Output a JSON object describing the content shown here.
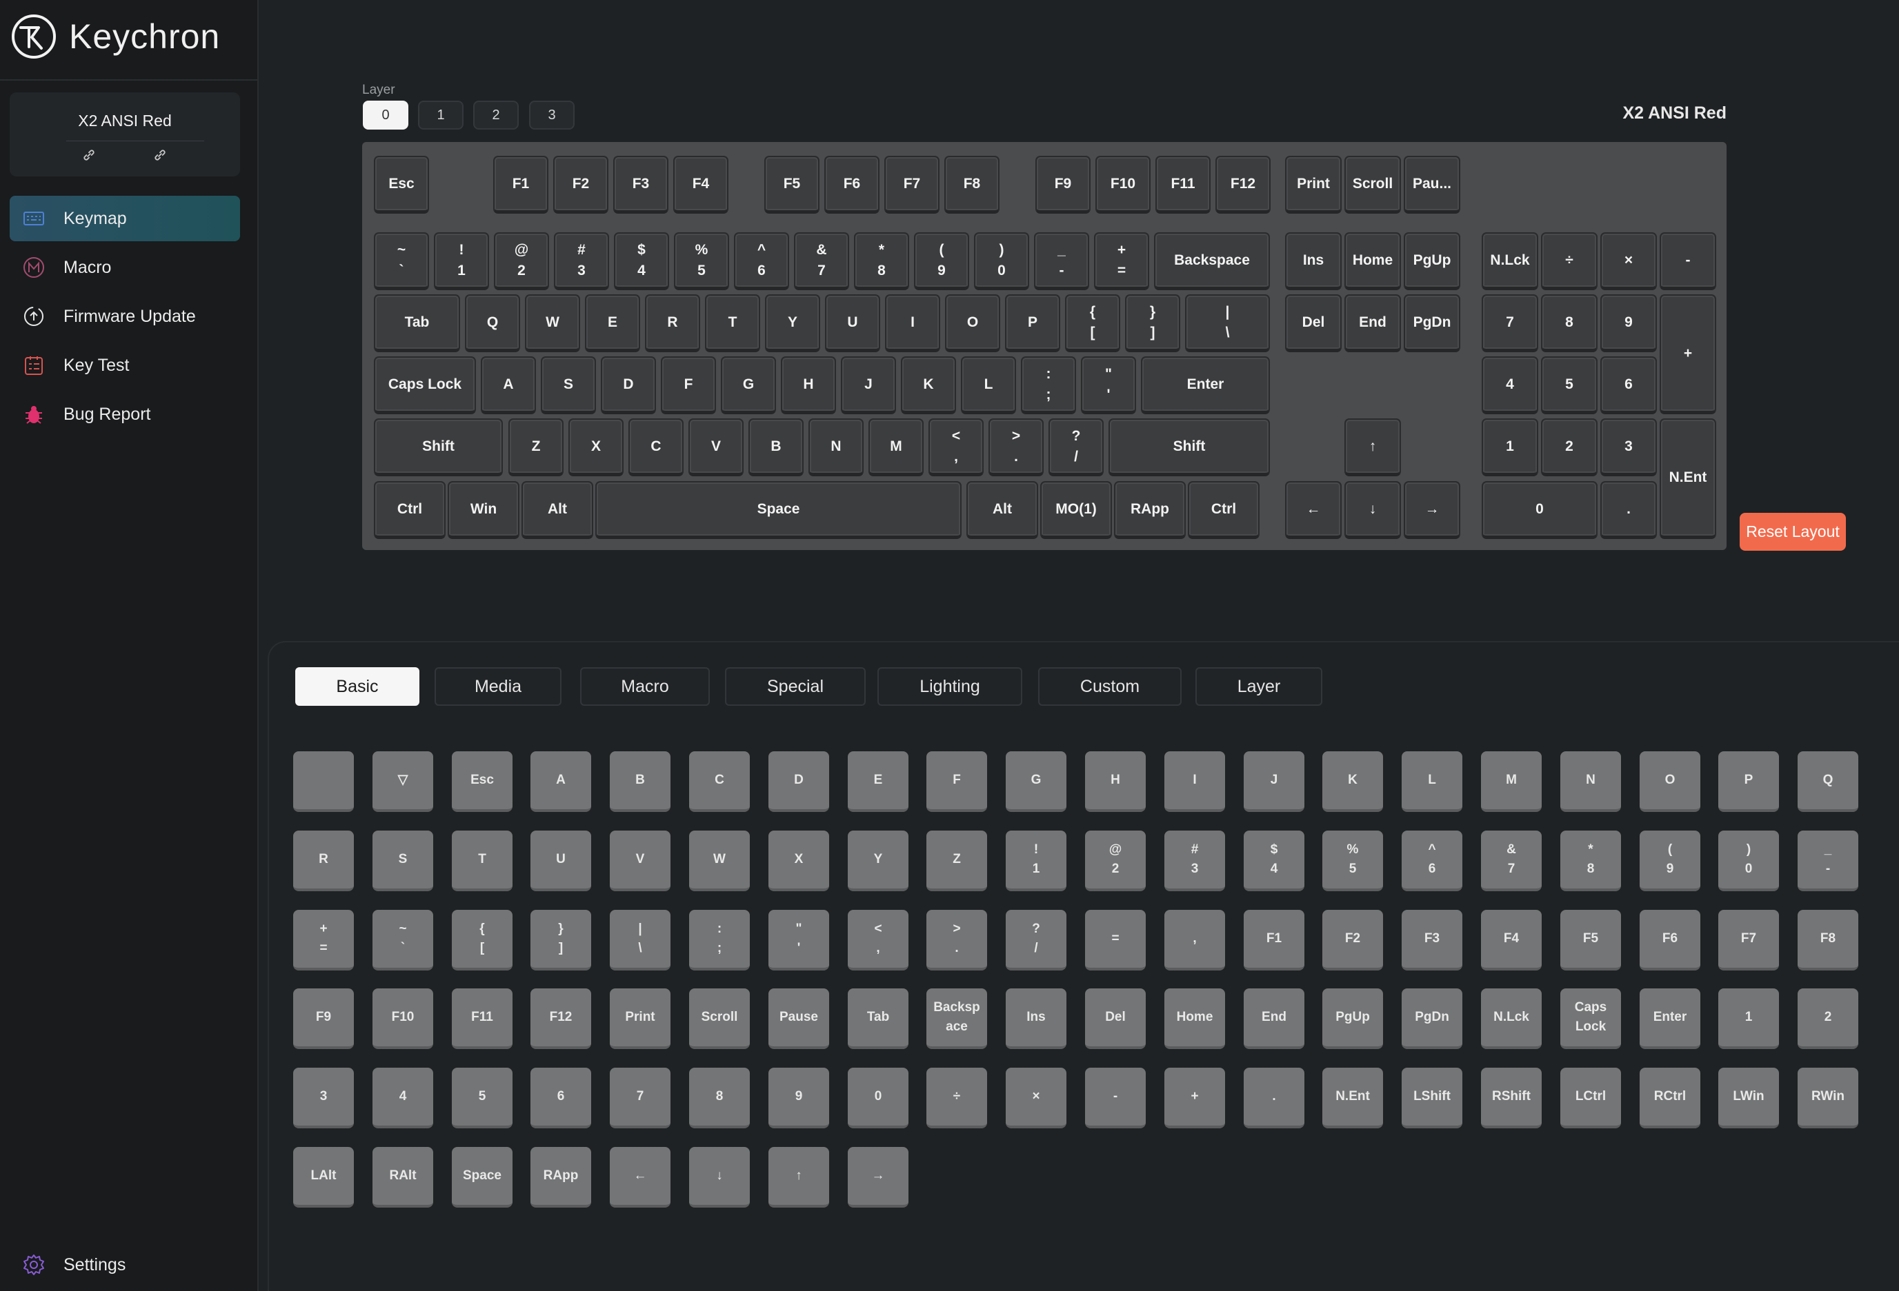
{
  "app": {
    "brand": "Keychron"
  },
  "device": {
    "name": "X2 ANSI Red"
  },
  "nav": [
    {
      "label": "Keymap",
      "icon": "keyboard-icon",
      "active": true
    },
    {
      "label": "Macro",
      "icon": "macro-icon"
    },
    {
      "label": "Firmware Update",
      "icon": "firmware-update-icon"
    },
    {
      "label": "Key Test",
      "icon": "key-test-icon"
    },
    {
      "label": "Bug Report",
      "icon": "bug-icon"
    }
  ],
  "settings": {
    "label": "Settings",
    "icon": "gear-icon"
  },
  "layers": {
    "label": "Layer",
    "items": [
      "0",
      "1",
      "2",
      "3"
    ],
    "active": 0
  },
  "keyboard": {
    "title": "X2 ANSI Red",
    "reset_label": "Reset Layout",
    "rows": [
      [
        [
          "Esc"
        ],
        [
          "F1"
        ],
        [
          "F2"
        ],
        [
          "F3"
        ],
        [
          "F4"
        ],
        [
          "F5"
        ],
        [
          "F6"
        ],
        [
          "F7"
        ],
        [
          "F8"
        ],
        [
          "F9"
        ],
        [
          "F10"
        ],
        [
          "F11"
        ],
        [
          "F12"
        ],
        [
          "Print"
        ],
        [
          "Scroll"
        ],
        [
          "Pau..."
        ]
      ],
      [
        [
          "~",
          "`"
        ],
        [
          "!",
          "1"
        ],
        [
          "@",
          "2"
        ],
        [
          "#",
          "3"
        ],
        [
          "$",
          "4"
        ],
        [
          "%",
          "5"
        ],
        [
          "^",
          "6"
        ],
        [
          "&",
          "7"
        ],
        [
          "*",
          "8"
        ],
        [
          "(",
          "9"
        ],
        [
          ")",
          "0"
        ],
        [
          "_",
          "-"
        ],
        [
          "+",
          "="
        ],
        [
          "Backspace"
        ],
        [
          "Ins"
        ],
        [
          "Home"
        ],
        [
          "PgUp"
        ],
        [
          "N.Lck"
        ],
        [
          "÷"
        ],
        [
          "×"
        ],
        [
          "-"
        ]
      ],
      [
        [
          "Tab"
        ],
        [
          "Q"
        ],
        [
          "W"
        ],
        [
          "E"
        ],
        [
          "R"
        ],
        [
          "T"
        ],
        [
          "Y"
        ],
        [
          "U"
        ],
        [
          "I"
        ],
        [
          "O"
        ],
        [
          "P"
        ],
        [
          "{",
          "["
        ],
        [
          "}",
          "]"
        ],
        [
          "|",
          "\\"
        ],
        [
          "Del"
        ],
        [
          "End"
        ],
        [
          "PgDn"
        ],
        [
          "7"
        ],
        [
          "8"
        ],
        [
          "9"
        ],
        [
          "+"
        ]
      ],
      [
        [
          "Caps Lock"
        ],
        [
          "A"
        ],
        [
          "S"
        ],
        [
          "D"
        ],
        [
          "F"
        ],
        [
          "G"
        ],
        [
          "H"
        ],
        [
          "J"
        ],
        [
          "K"
        ],
        [
          "L"
        ],
        [
          ":",
          ";"
        ],
        [
          "\"",
          "'"
        ],
        [
          "Enter"
        ],
        [
          "4"
        ],
        [
          "5"
        ],
        [
          "6"
        ]
      ],
      [
        [
          "Shift"
        ],
        [
          "Z"
        ],
        [
          "X"
        ],
        [
          "C"
        ],
        [
          "V"
        ],
        [
          "B"
        ],
        [
          "N"
        ],
        [
          "M"
        ],
        [
          "<",
          ","
        ],
        [
          ">",
          "."
        ],
        [
          "?",
          "/"
        ],
        [
          "Shift"
        ],
        [
          "↑"
        ],
        [
          "1"
        ],
        [
          "2"
        ],
        [
          "3"
        ],
        [
          "N.Ent"
        ]
      ],
      [
        [
          "Ctrl"
        ],
        [
          "Win"
        ],
        [
          "Alt"
        ],
        [
          "Space"
        ],
        [
          "Alt"
        ],
        [
          "MO(1)"
        ],
        [
          "RApp"
        ],
        [
          "Ctrl"
        ],
        [
          "←"
        ],
        [
          "↓"
        ],
        [
          "→"
        ],
        [
          "0"
        ],
        [
          "."
        ]
      ]
    ]
  },
  "tabs": [
    "Basic",
    "Media",
    "Macro",
    "Special",
    "Lighting",
    "Custom",
    "Layer"
  ],
  "active_tab": 0,
  "palette": [
    [
      [
        ""
      ],
      [
        "▽"
      ],
      [
        "Esc"
      ],
      [
        "A"
      ],
      [
        "B"
      ],
      [
        "C"
      ],
      [
        "D"
      ],
      [
        "E"
      ],
      [
        "F"
      ],
      [
        "G"
      ],
      [
        "H"
      ],
      [
        "I"
      ],
      [
        "J"
      ],
      [
        "K"
      ],
      [
        "L"
      ],
      [
        "M"
      ],
      [
        "N"
      ],
      [
        "O"
      ],
      [
        "P"
      ],
      [
        "Q"
      ]
    ],
    [
      [
        "R"
      ],
      [
        "S"
      ],
      [
        "T"
      ],
      [
        "U"
      ],
      [
        "V"
      ],
      [
        "W"
      ],
      [
        "X"
      ],
      [
        "Y"
      ],
      [
        "Z"
      ],
      [
        "!",
        "1"
      ],
      [
        "@",
        "2"
      ],
      [
        "#",
        "3"
      ],
      [
        "$",
        "4"
      ],
      [
        "%",
        "5"
      ],
      [
        "^",
        "6"
      ],
      [
        "&",
        "7"
      ],
      [
        "*",
        "8"
      ],
      [
        "(",
        "9"
      ],
      [
        ")",
        "0"
      ],
      [
        "_",
        "-"
      ]
    ],
    [
      [
        "+",
        "="
      ],
      [
        "~",
        "`"
      ],
      [
        "{",
        "["
      ],
      [
        "}",
        "]"
      ],
      [
        "|",
        "\\"
      ],
      [
        ":",
        ";"
      ],
      [
        "\"",
        "'"
      ],
      [
        "<",
        ","
      ],
      [
        ">",
        "."
      ],
      [
        "?",
        "/"
      ],
      [
        "="
      ],
      [
        ","
      ],
      [
        "F1"
      ],
      [
        "F2"
      ],
      [
        "F3"
      ],
      [
        "F4"
      ],
      [
        "F5"
      ],
      [
        "F6"
      ],
      [
        "F7"
      ],
      [
        "F8"
      ]
    ],
    [
      [
        "F9"
      ],
      [
        "F10"
      ],
      [
        "F11"
      ],
      [
        "F12"
      ],
      [
        "Print"
      ],
      [
        "Scroll"
      ],
      [
        "Pause"
      ],
      [
        "Tab"
      ],
      [
        "Backsp",
        "ace"
      ],
      [
        "Ins"
      ],
      [
        "Del"
      ],
      [
        "Home"
      ],
      [
        "End"
      ],
      [
        "PgUp"
      ],
      [
        "PgDn"
      ],
      [
        "N.Lck"
      ],
      [
        "Caps",
        "Lock"
      ],
      [
        "Enter"
      ],
      [
        "1"
      ],
      [
        "2"
      ]
    ],
    [
      [
        "3"
      ],
      [
        "4"
      ],
      [
        "5"
      ],
      [
        "6"
      ],
      [
        "7"
      ],
      [
        "8"
      ],
      [
        "9"
      ],
      [
        "0"
      ],
      [
        "÷"
      ],
      [
        "×"
      ],
      [
        "-"
      ],
      [
        "+"
      ],
      [
        "."
      ],
      [
        "N.Ent"
      ],
      [
        "LShift"
      ],
      [
        "RShift"
      ],
      [
        "LCtrl"
      ],
      [
        "RCtrl"
      ],
      [
        "LWin"
      ],
      [
        "RWin"
      ]
    ],
    [
      [
        "LAlt"
      ],
      [
        "RAlt"
      ],
      [
        "Space"
      ],
      [
        "RApp"
      ],
      [
        "←"
      ],
      [
        "↓"
      ],
      [
        "↑"
      ],
      [
        "→"
      ]
    ]
  ],
  "colors": {
    "accent": "#f26a4c",
    "active_nav": "#2a5063",
    "keyboard_case": "#4b4c4e",
    "keycap": "#3c3d3f",
    "palette_key": "#747576"
  }
}
